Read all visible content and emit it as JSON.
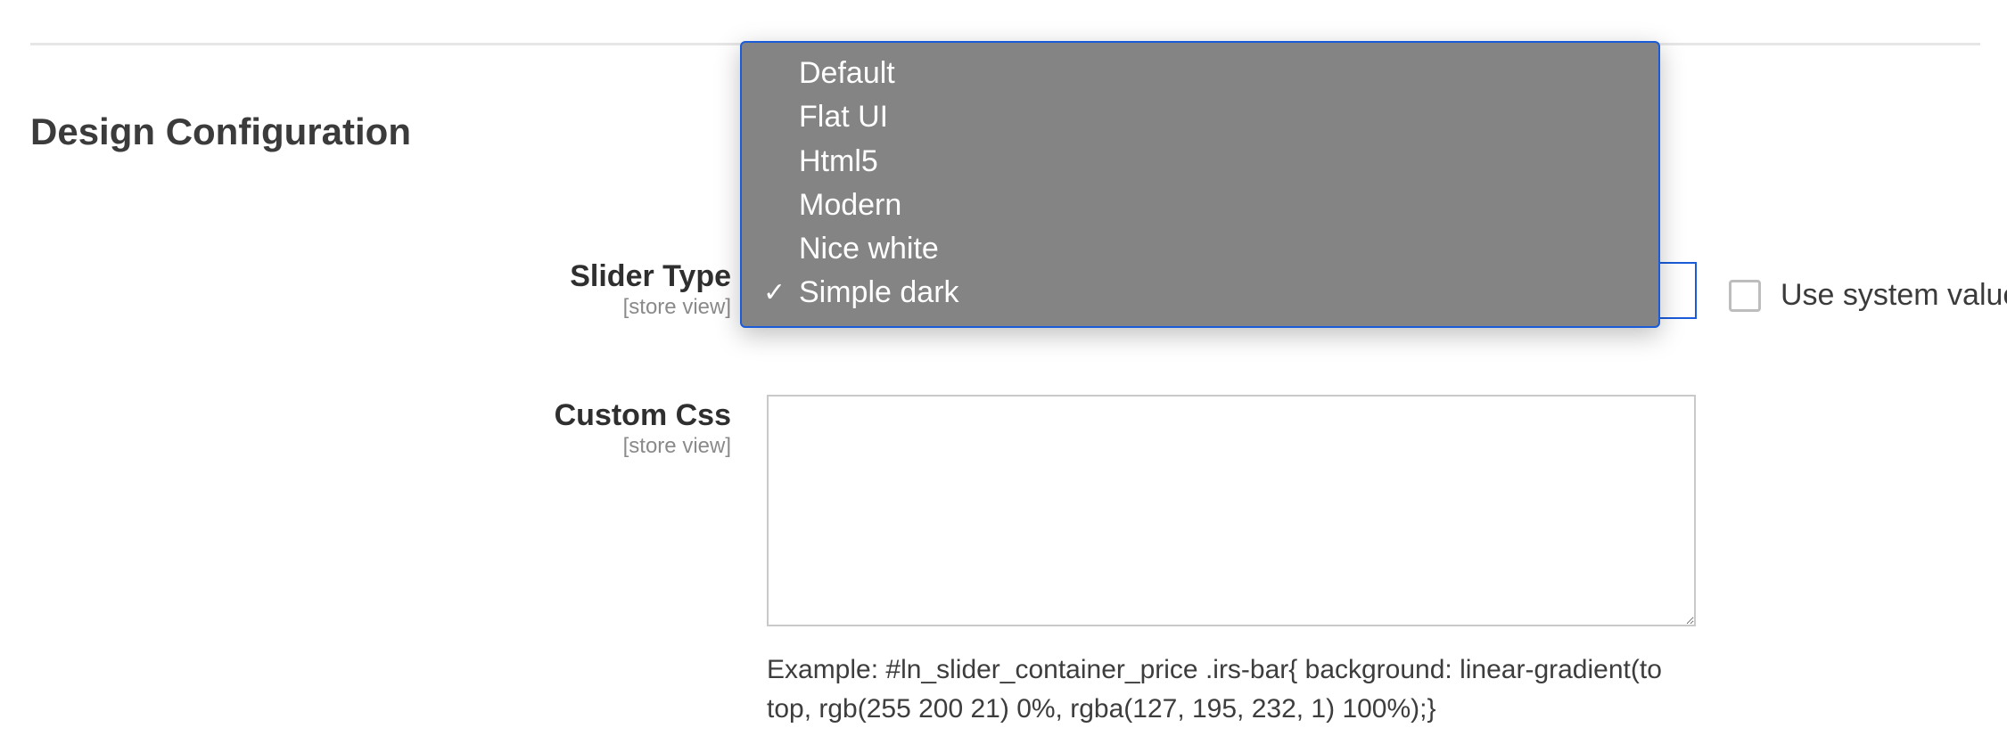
{
  "section_title": "Design Configuration",
  "fields": {
    "slider_type": {
      "label": "Slider Type",
      "scope": "[store view]",
      "options": [
        "Default",
        "Flat UI",
        "Html5",
        "Modern",
        "Nice white",
        "Simple dark"
      ],
      "selected": "Simple dark",
      "use_system_value_label": "Use system value",
      "use_system_value_checked": false
    },
    "custom_css": {
      "label": "Custom Css",
      "scope": "[store view]",
      "value": "",
      "hint": "Example: #ln_slider_container_price .irs-bar{ background: linear-gradient(to top, rgb(255 200 21) 0%, rgba(127, 195, 232, 1) 100%);}"
    }
  }
}
